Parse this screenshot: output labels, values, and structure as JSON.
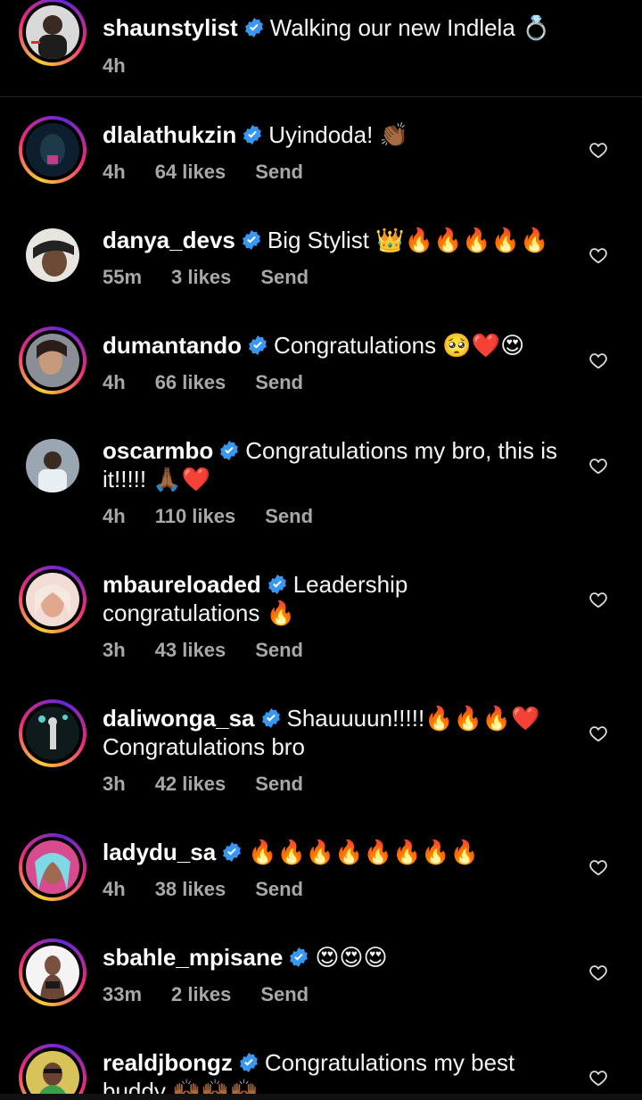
{
  "caption": {
    "username": "shaunstylist",
    "text": "Walking our new Indlela 💍",
    "time": "4h"
  },
  "comments": [
    {
      "username": "dlalathukzin",
      "text": "Uyindoda! 👏🏾",
      "time": "4h",
      "likes": "64 likes",
      "send": "Send"
    },
    {
      "username": "danya_devs",
      "text": "Big Stylist 👑🔥🔥🔥🔥🔥",
      "time": "55m",
      "likes": "3 likes",
      "send": "Send"
    },
    {
      "username": "dumantando",
      "text": "Congratulations 🥺❤️😍",
      "time": "4h",
      "likes": "66 likes",
      "send": "Send"
    },
    {
      "username": "oscarmbo",
      "text": "Congratulations my bro, this is it!!!!! 🙏🏾❤️",
      "time": "4h",
      "likes": "110 likes",
      "send": "Send"
    },
    {
      "username": "mbaureloaded",
      "text": "Leadership congratulations 🔥",
      "time": "3h",
      "likes": "43 likes",
      "send": "Send"
    },
    {
      "username": "daliwonga_sa",
      "text": "Shauuuun!!!!!🔥🔥🔥❤️ Congratulations bro",
      "time": "3h",
      "likes": "42 likes",
      "send": "Send"
    },
    {
      "username": "ladydu_sa",
      "text": "🔥🔥🔥🔥🔥🔥🔥🔥",
      "time": "4h",
      "likes": "38 likes",
      "send": "Send"
    },
    {
      "username": "sbahle_mpisane",
      "text": "😍😍😍",
      "time": "33m",
      "likes": "2 likes",
      "send": "Send"
    },
    {
      "username": "realdjbongz",
      "text": "Congratulations my best buddy 🙌🏾🙌🏾🙌🏾",
      "time": "",
      "likes": "",
      "send": ""
    }
  ],
  "colors": {
    "background": "#000000",
    "verified": "#3897f0",
    "meta": "#a8a8a8",
    "divider": "#262626"
  },
  "icons": {
    "verified": "verified-badge-icon",
    "like": "heart-outline-icon"
  }
}
